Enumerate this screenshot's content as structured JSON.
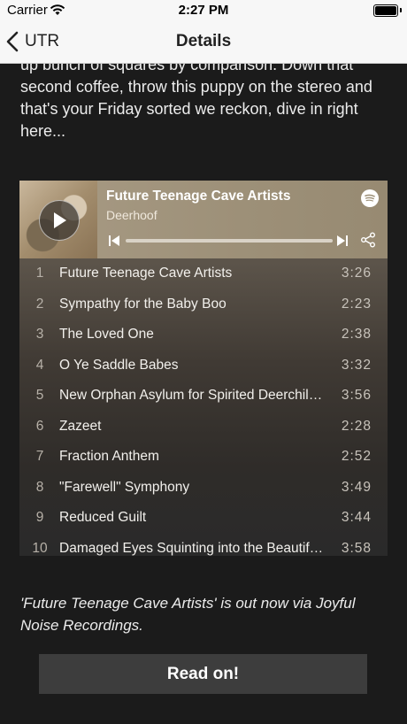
{
  "status_bar": {
    "carrier": "Carrier",
    "time": "2:27 PM"
  },
  "nav": {
    "back_label": "UTR",
    "title": "Details"
  },
  "article": {
    "intro": "up bunch of squares by comparison. Down that second coffee, throw this puppy on the stereo and that's your Friday sorted we reckon, dive in right here...",
    "caption": "'Future Teenage Cave Artists' is out now via Joyful Noise Recordings.",
    "read_more_label": "Read on!"
  },
  "player": {
    "title": "Future Teenage Cave Artists",
    "artist": "Deerhoof",
    "progress": 0,
    "tracks": [
      {
        "num": "1",
        "title": "Future Teenage Cave Artists",
        "duration": "3:26"
      },
      {
        "num": "2",
        "title": "Sympathy for the Baby Boo",
        "duration": "2:23"
      },
      {
        "num": "3",
        "title": "The Loved One",
        "duration": "2:38"
      },
      {
        "num": "4",
        "title": "O Ye Saddle Babes",
        "duration": "3:32"
      },
      {
        "num": "5",
        "title": "New Orphan Asylum for Spirited Deerchildr...",
        "duration": "3:56"
      },
      {
        "num": "6",
        "title": "Zazeet",
        "duration": "2:28"
      },
      {
        "num": "7",
        "title": "Fraction Anthem",
        "duration": "2:52"
      },
      {
        "num": "8",
        "title": "\"Farewell\" Symphony",
        "duration": "3:49"
      },
      {
        "num": "9",
        "title": "Reduced Guilt",
        "duration": "3:44"
      },
      {
        "num": "10",
        "title": "Damaged Eyes Squinting into the Beautiful ...",
        "duration": "3:58"
      }
    ]
  },
  "icons": {
    "back": "chevron-left-icon",
    "play": "play-icon",
    "spotify": "spotify-icon",
    "prev": "skip-previous-icon",
    "next": "skip-next-icon",
    "share": "share-icon"
  },
  "colors": {
    "background": "#1b1b1b",
    "button": "#3d3d3d",
    "player_header": "#a89b85"
  }
}
